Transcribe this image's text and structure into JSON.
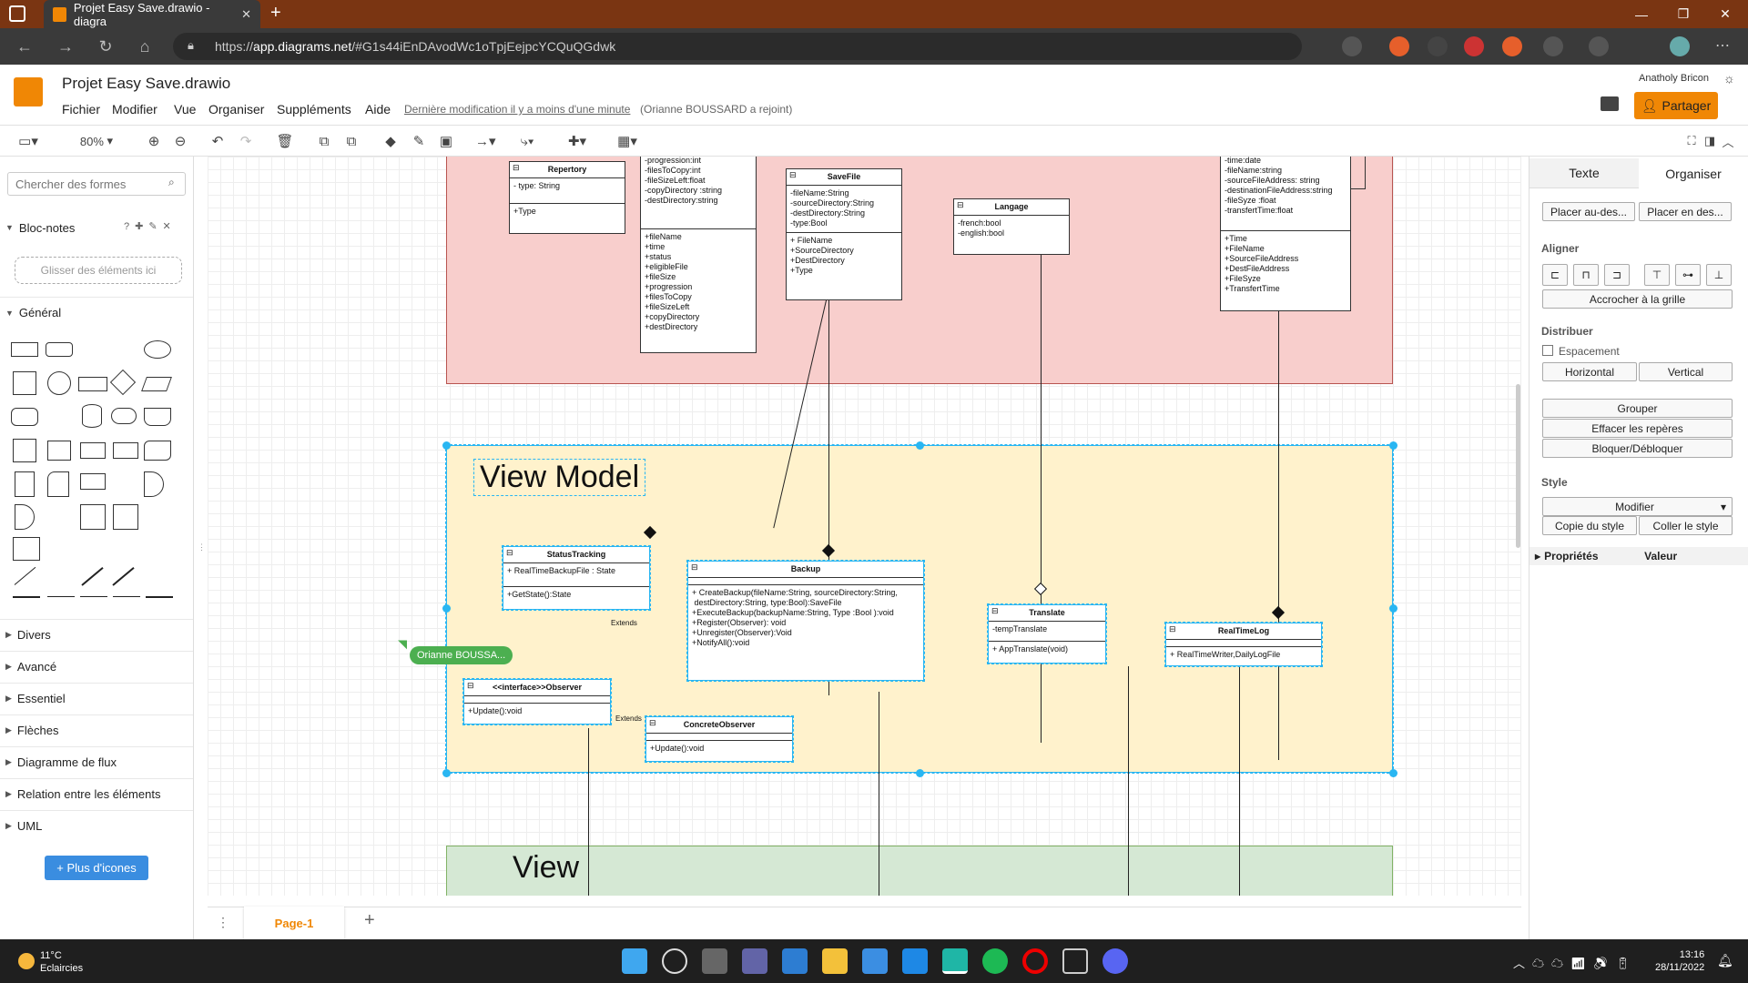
{
  "browser": {
    "tab_title": "Projet Easy Save.drawio - diagra",
    "url_prefix": "https://",
    "url_host": "app.diagrams.net",
    "url_path": "/#G1s44iEnDAvodWc1oTpjEejpcYCQuQGdwk"
  },
  "app": {
    "doc_title": "Projet Easy Save.drawio",
    "menus": [
      "Fichier",
      "Modifier",
      "Vue",
      "Organiser",
      "Suppléments",
      "Aide"
    ],
    "last_modified": "Dernière modification il y a moins d'une minute",
    "joined": "(Orianne BOUSSARD a rejoint)",
    "user": "Anatholy Bricon",
    "share_label": "Partager",
    "zoom": "80%"
  },
  "left_panel": {
    "search_placeholder": "Chercher des formes",
    "notepad": "Bloc-notes",
    "dropzone": "Glisser des éléments ici",
    "general": "Général",
    "sections": [
      "Divers",
      "Avancé",
      "Essentiel",
      "Flèches",
      "Diagramme de flux",
      "Relation entre les éléments",
      "UML"
    ],
    "more_icons": "+ Plus d'icones"
  },
  "diagram": {
    "view_model_label": "View Model",
    "view_label": "View",
    "cursor_user": "Orianne BOUSSA...",
    "extends_1": "Extends",
    "extends_2": "Extends",
    "classes": {
      "repertory": {
        "name": "Repertory",
        "attrs": "- type: String",
        "methods": "+Type"
      },
      "unnamed_top": {
        "attrs": "-progression:int\n-filesToCopy:int\n-fileSizeLeft:float\n-copyDirectory :string\n-destDirectory:string",
        "methods": "+fileName\n+time\n+status\n+eligibleFile\n+fileSize\n+progression\n+filesToCopy\n+fileSizeLeft\n+copyDirectory\n+destDirectory"
      },
      "savefile": {
        "name": "SaveFile",
        "attrs": "-fileName:String\n-sourceDirectory:String\n-destDirectory:String\n-type:Bool",
        "methods": "+ FileName\n+SourceDirectory\n+DestDirectory\n+Type"
      },
      "langage": {
        "name": "Langage",
        "attrs": "-french:bool\n-english:bool",
        "methods": ""
      },
      "log_top": {
        "attrs": "-time:date\n-fileName:string\n-sourceFileAddress: string\n-destinationFileAddress:string\n-fileSyze :float\n-transfertTime:float",
        "methods": "+Time\n+FileName\n+SourceFileAddress\n+DestFileAddress\n+FileSyze\n+TransfertTime"
      },
      "statustracking": {
        "name": "StatusTracking",
        "attrs": "+ RealTimeBackupFile : State",
        "methods": "+GetState():State"
      },
      "backup": {
        "name": "Backup",
        "attrs": "",
        "methods": "+ CreateBackup(fileName:String, sourceDirectory:String,\n destDirectory:String, type:Bool):SaveFile\n+ExecuteBackup(backupName:String, Type :Bool ):void\n+Register(Observer): void\n+Unregister(Observer):Void\n+NotifyAll():void"
      },
      "translate": {
        "name": "Translate",
        "attrs": "-tempTranslate",
        "methods": "+ AppTranslate(void)"
      },
      "realtimelog": {
        "name": "RealTimeLog",
        "attrs": "",
        "methods": "+ RealTimeWriter,DailyLogFile"
      },
      "observer": {
        "name": "<<interface>>Observer",
        "attrs": "",
        "methods": "+Update():void"
      },
      "concreteobserver": {
        "name": "ConcreteObserver",
        "attrs": "",
        "methods": "+Update():void"
      }
    }
  },
  "right_panel": {
    "tab_text": "Texte",
    "tab_arrange": "Organiser",
    "to_front": "Placer au-des...",
    "to_back": "Placer en des...",
    "align": "Aligner",
    "snap_grid": "Accrocher à la grille",
    "distribute": "Distribuer",
    "spacing": "Espacement",
    "horizontal": "Horizontal",
    "vertical": "Vertical",
    "group": "Grouper",
    "clear_guides": "Effacer les repères",
    "lock": "Bloquer/Débloquer",
    "style": "Style",
    "style_select": "Modifier",
    "copy_style": "Copie du style",
    "paste_style": "Coller le style",
    "properties": "Propriétés",
    "value": "Valeur"
  },
  "page_tab": "Page-1",
  "taskbar": {
    "temp": "11°C",
    "weather": "Eclaircies",
    "time": "13:16",
    "date": "28/11/2022"
  },
  "colors": {
    "accent": "#f08705",
    "selection": "#29b6f2",
    "swim_red": "#f8cecc",
    "swim_yellow": "#fff2cc",
    "swim_green": "#d5e8d4"
  }
}
